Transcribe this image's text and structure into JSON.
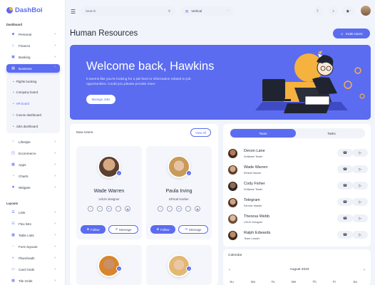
{
  "app": {
    "name": "DashBoi",
    "page_title": "Human Resources",
    "search_placeholder": "Search",
    "layout_mode": "Vertical",
    "invite_label": "Invite Users"
  },
  "sidebar": {
    "section_dashboard": "Dashboard",
    "dashboard_items": [
      {
        "label": "Personal",
        "icon": "user-icon"
      },
      {
        "label": "Finance",
        "icon": "bank-icon"
      },
      {
        "label": "Banking",
        "icon": "wallet-icon"
      },
      {
        "label": "Business",
        "icon": "briefcase-icon"
      }
    ],
    "business_sub": [
      "Flights booking",
      "Company board",
      "HR board",
      "Course dashboard",
      "Jobs dashboard"
    ],
    "more_items": [
      {
        "label": "Lifestyle",
        "icon": "heart-icon"
      },
      {
        "label": "Ecommerce",
        "icon": "cart-icon"
      },
      {
        "label": "Apps",
        "icon": "grid-icon"
      },
      {
        "label": "Charts",
        "icon": "chart-icon"
      },
      {
        "label": "Widgets",
        "icon": "puzzle-icon"
      }
    ],
    "section_layouts": "Layouts",
    "layout_items": [
      {
        "label": "Lists",
        "icon": "list-icon"
      },
      {
        "label": "Flex lists",
        "icon": "flex-icon"
      },
      {
        "label": "Table Lists",
        "icon": "table-icon"
      },
      {
        "label": "Form layouts",
        "icon": "form-icon"
      },
      {
        "label": "Placeloads",
        "icon": "loader-icon"
      },
      {
        "label": "Card Grids",
        "icon": "cards-icon"
      },
      {
        "label": "Tile Grids",
        "icon": "tiles-icon"
      }
    ]
  },
  "banner": {
    "title": "Welcome back, Hawkins",
    "text": "It seems like you're looking for a job feed or information related to job opportunities. Could you please provide more",
    "button": "Manage Jobs"
  },
  "new_users": {
    "title": "New Users",
    "view_all": "View All",
    "follow_label": "Follow",
    "message_label": "Message",
    "users": [
      {
        "name": "Wade Warren",
        "role": "UI/UX designer"
      },
      {
        "name": "Paula Irving",
        "role": "Ethical Hacker"
      }
    ]
  },
  "team": {
    "tabs": [
      "Team",
      "Tasks"
    ],
    "members": [
      {
        "name": "Devon Lane",
        "role": "Software Tester"
      },
      {
        "name": "Wade Warren",
        "role": "Ethical Hacker"
      },
      {
        "name": "Cody Fisher",
        "role": "Software Tester"
      },
      {
        "name": "Telegram",
        "role": "Service Master"
      },
      {
        "name": "Theresa Webb",
        "role": "UI/UX Designer"
      },
      {
        "name": "Ralph Edwards",
        "role": "Team Leader"
      }
    ]
  },
  "calendar": {
    "title": "Calendar",
    "month": "August 2023",
    "days": [
      "Su",
      "Mo",
      "Tu",
      "We",
      "Th",
      "Fr",
      "Sa"
    ]
  },
  "colors": {
    "accent": "#5b6cf0",
    "background": "#f1f4fa"
  }
}
